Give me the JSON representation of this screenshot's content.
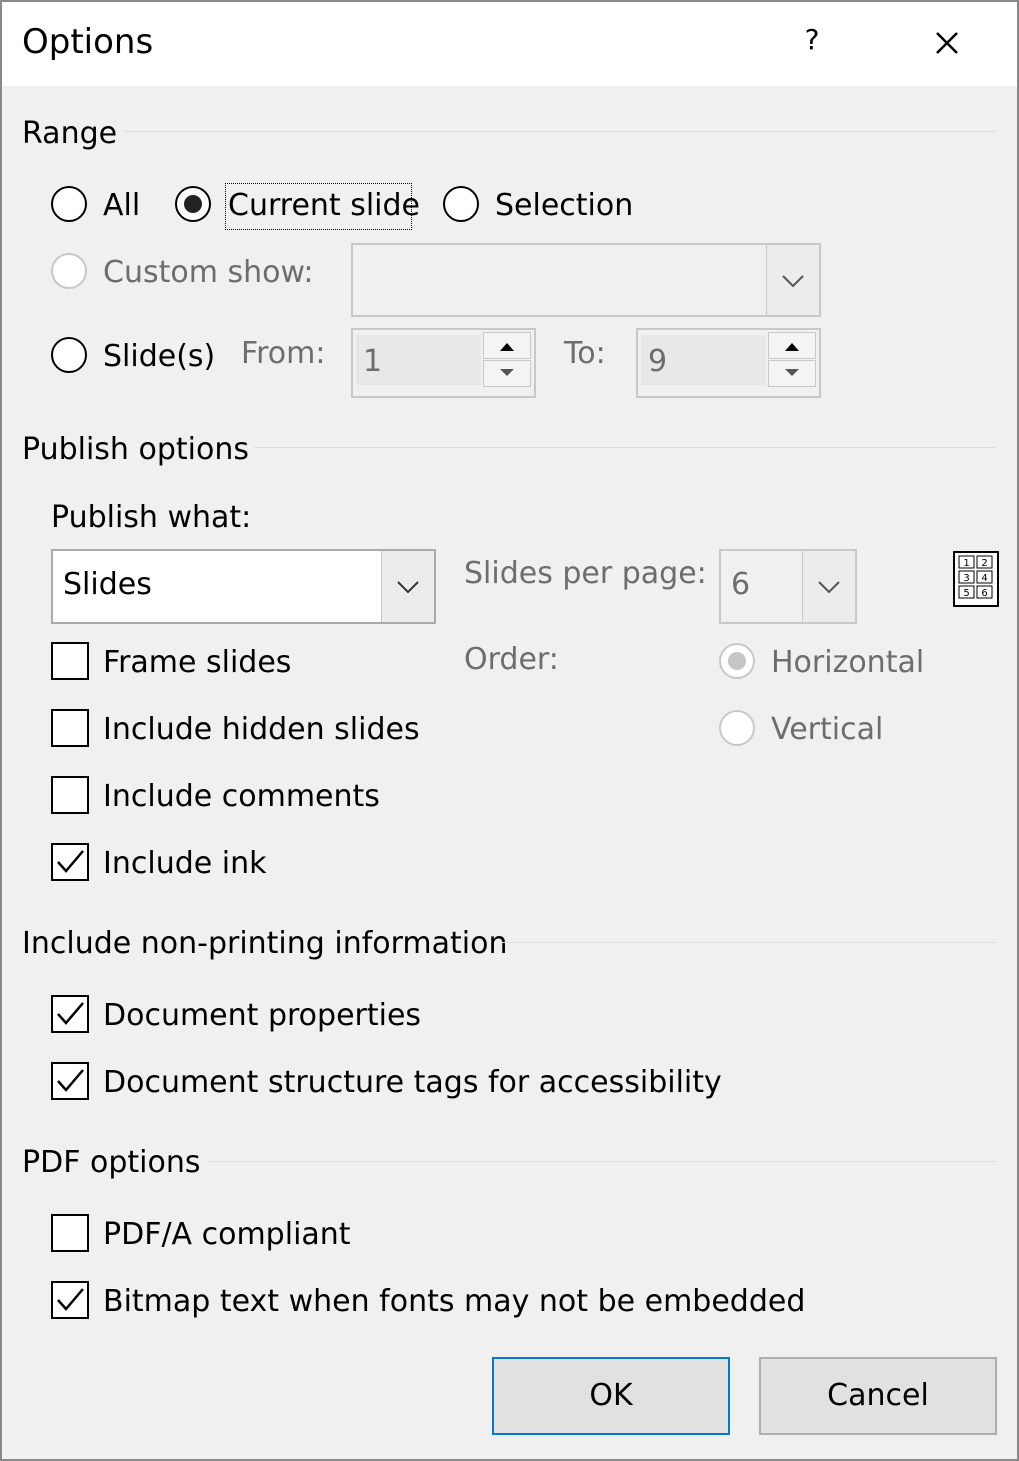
{
  "dialog": {
    "title": "Options",
    "help_label": "?",
    "close_icon": "close-icon"
  },
  "range": {
    "heading": "Range",
    "all_label": "All",
    "current_slide_label": "Current slide",
    "selection_label": "Selection",
    "selected": "current_slide",
    "custom_show_label": "Custom show:",
    "custom_show_value": "",
    "slides_label": "Slide(s)",
    "from_label": "From:",
    "from_value": "1",
    "to_label": "To:",
    "to_value": "9"
  },
  "publish": {
    "heading": "Publish options",
    "what_label": "Publish what:",
    "what_value": "Slides",
    "slides_per_page_label": "Slides per page:",
    "slides_per_page_value": "6",
    "order_label": "Order:",
    "horizontal_label": "Horizontal",
    "vertical_label": "Vertical",
    "order_selected": "horizontal",
    "frame_slides_label": "Frame slides",
    "frame_slides_checked": false,
    "hidden_slides_label": "Include hidden slides",
    "hidden_slides_checked": false,
    "comments_label": "Include comments",
    "comments_checked": false,
    "ink_label": "Include ink",
    "ink_checked": true,
    "layout_preview_numbers": [
      "1",
      "2",
      "3",
      "4",
      "5",
      "6"
    ]
  },
  "nonprinting": {
    "heading": "Include non-printing information",
    "doc_props_label": "Document properties",
    "doc_props_checked": true,
    "structure_tags_label": "Document structure tags for accessibility",
    "structure_tags_checked": true
  },
  "pdf": {
    "heading": "PDF options",
    "pdfa_label": "PDF/A compliant",
    "pdfa_checked": false,
    "bitmap_label": "Bitmap text when fonts may not be embedded",
    "bitmap_checked": true
  },
  "buttons": {
    "ok_label": "OK",
    "cancel_label": "Cancel"
  },
  "colors": {
    "default_button_border": "#0078d7",
    "disabled_text": "#6d6d6d"
  }
}
